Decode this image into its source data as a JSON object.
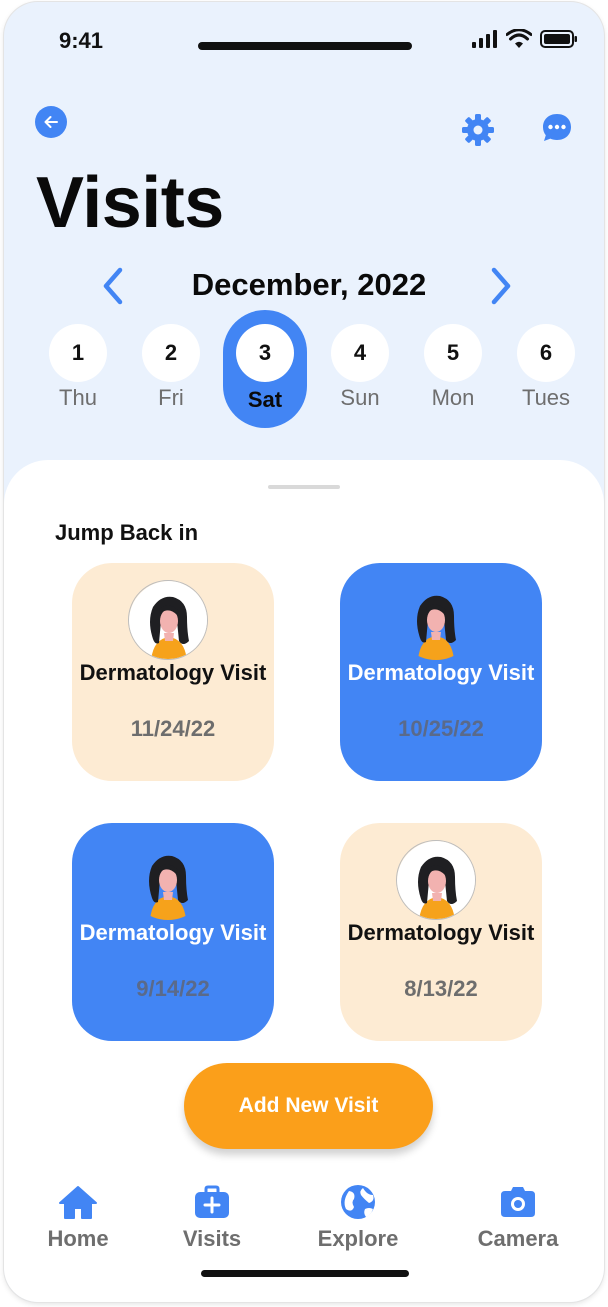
{
  "status_bar": {
    "time": "9:41"
  },
  "header": {
    "title": "Visits",
    "back_icon": "arrow-left-icon",
    "settings_icon": "gear-icon",
    "chat_icon": "chat-bubble-icon",
    "accent_color": "#4285f4"
  },
  "calendar": {
    "month_label": "December, 2022",
    "days": [
      {
        "num": "1",
        "name": "Thu",
        "selected": false
      },
      {
        "num": "2",
        "name": "Fri",
        "selected": false
      },
      {
        "num": "3",
        "name": "Sat",
        "selected": true
      },
      {
        "num": "4",
        "name": "Sun",
        "selected": false
      },
      {
        "num": "5",
        "name": "Mon",
        "selected": false
      },
      {
        "num": "6",
        "name": "Tues",
        "selected": false
      }
    ]
  },
  "jump_back": {
    "section_title": "Jump Back in",
    "cards": [
      {
        "title": "Dermatology Visit",
        "date": "11/24/22",
        "style": "peach"
      },
      {
        "title": "Dermatology Visit",
        "date": "10/25/22",
        "style": "blue"
      },
      {
        "title": "Dermatology Visit",
        "date": "9/14/22",
        "style": "blue"
      },
      {
        "title": "Dermatology Visit",
        "date": "8/13/22",
        "style": "peach"
      }
    ]
  },
  "add_button": {
    "label": "Add New Visit",
    "color": "#fb9f1a"
  },
  "bottom_nav": [
    {
      "label": "Home",
      "icon": "home-icon"
    },
    {
      "label": "Visits",
      "icon": "medical-kit-icon"
    },
    {
      "label": "Explore",
      "icon": "globe-icon"
    },
    {
      "label": "Camera",
      "icon": "camera-icon"
    }
  ]
}
